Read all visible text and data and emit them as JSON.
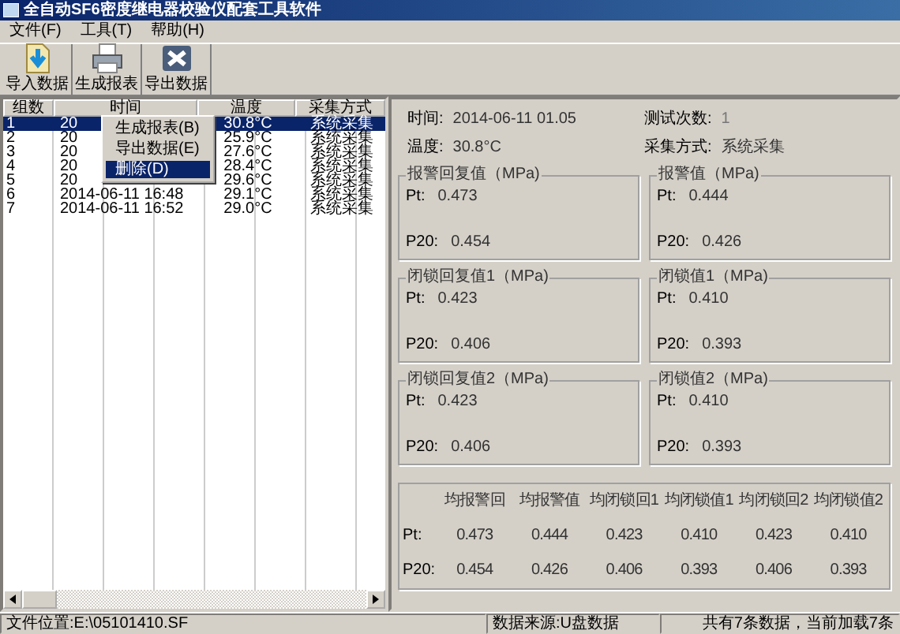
{
  "window": {
    "title": "全自动SF6密度继电器校验仪配套工具软件"
  },
  "menu": [
    "文件(F)",
    "工具(T)",
    "帮助(H)"
  ],
  "toolbar": [
    {
      "kind": "import",
      "label": "导入数据"
    },
    {
      "kind": "report",
      "label": "生成报表"
    },
    {
      "kind": "export",
      "label": "导出数据"
    }
  ],
  "table": {
    "columns": [
      "组数",
      "时间",
      "温度",
      "采集方式"
    ],
    "rows": [
      {
        "cells": [
          "1",
          "20",
          "30.8°C",
          "系统采集"
        ],
        "selected": true
      },
      {
        "cells": [
          "2",
          "20",
          "25.9°C",
          "系统采集"
        ],
        "selected": false
      },
      {
        "cells": [
          "3",
          "20",
          "27.6°C",
          "系统采集"
        ],
        "selected": false
      },
      {
        "cells": [
          "4",
          "20",
          "28.4°C",
          "系统采集"
        ],
        "selected": false
      },
      {
        "cells": [
          "5",
          "20",
          "29.6°C",
          "系统采集"
        ],
        "selected": false
      },
      {
        "cells": [
          "6",
          "2014-06-11 16:48",
          "29.1°C",
          "系统采集"
        ],
        "selected": false
      },
      {
        "cells": [
          "7",
          "2014-06-11 16:52",
          "29.0°C",
          "系统采集"
        ],
        "selected": false
      }
    ]
  },
  "context_menu": [
    {
      "label": "生成报表(B)",
      "selected": false
    },
    {
      "label": "导出数据(E)",
      "selected": false
    },
    {
      "label": "删除(D)",
      "selected": true
    }
  ],
  "info": [
    {
      "label": "时间:",
      "value": "2014-06-11 01.05"
    },
    {
      "label": "测试次数:",
      "value": "1"
    },
    {
      "label": "温度:",
      "value": "30.8°C"
    },
    {
      "label": "采集方式:",
      "value": "系统采集"
    }
  ],
  "groups": [
    {
      "title": "报警回复值（MPa)",
      "rows": [
        {
          "label": "Pt:",
          "value": "0.473"
        },
        {
          "label": "P20:",
          "value": "0.454"
        }
      ]
    },
    {
      "title": "报警值（MPa)",
      "rows": [
        {
          "label": "Pt:",
          "value": "0.444"
        },
        {
          "label": "P20:",
          "value": "0.426"
        }
      ]
    },
    {
      "title": "闭锁回复值1（MPa)",
      "rows": [
        {
          "label": "Pt:",
          "value": "0.423"
        },
        {
          "label": "P20:",
          "value": "0.406"
        }
      ]
    },
    {
      "title": "闭锁值1（MPa)",
      "rows": [
        {
          "label": "Pt:",
          "value": "0.410"
        },
        {
          "label": "P20:",
          "value": "0.393"
        }
      ]
    },
    {
      "title": "闭锁回复值2（MPa)",
      "rows": [
        {
          "label": "Pt:",
          "value": "0.423"
        },
        {
          "label": "P20:",
          "value": "0.406"
        }
      ]
    },
    {
      "title": "闭锁值2（MPa)",
      "rows": [
        {
          "label": "Pt:",
          "value": "0.410"
        },
        {
          "label": "P20:",
          "value": "0.393"
        }
      ]
    }
  ],
  "summary": {
    "columns": [
      "均报警回",
      "均报警值",
      "均闭锁回1",
      "均闭锁值1",
      "均闭锁回2",
      "均闭锁值2"
    ],
    "rows": [
      {
        "label": "Pt:",
        "values": [
          "0.473",
          "0.444",
          "0.423",
          "0.410",
          "0.423",
          "0.410"
        ]
      },
      {
        "label": "P20:",
        "values": [
          "0.454",
          "0.426",
          "0.406",
          "0.393",
          "0.406",
          "0.393"
        ]
      }
    ]
  },
  "status_bar": [
    "文件位置:E:\\05101410.SF",
    "数据来源:U盘数据",
    "共有7条数据，当前加载7条"
  ]
}
